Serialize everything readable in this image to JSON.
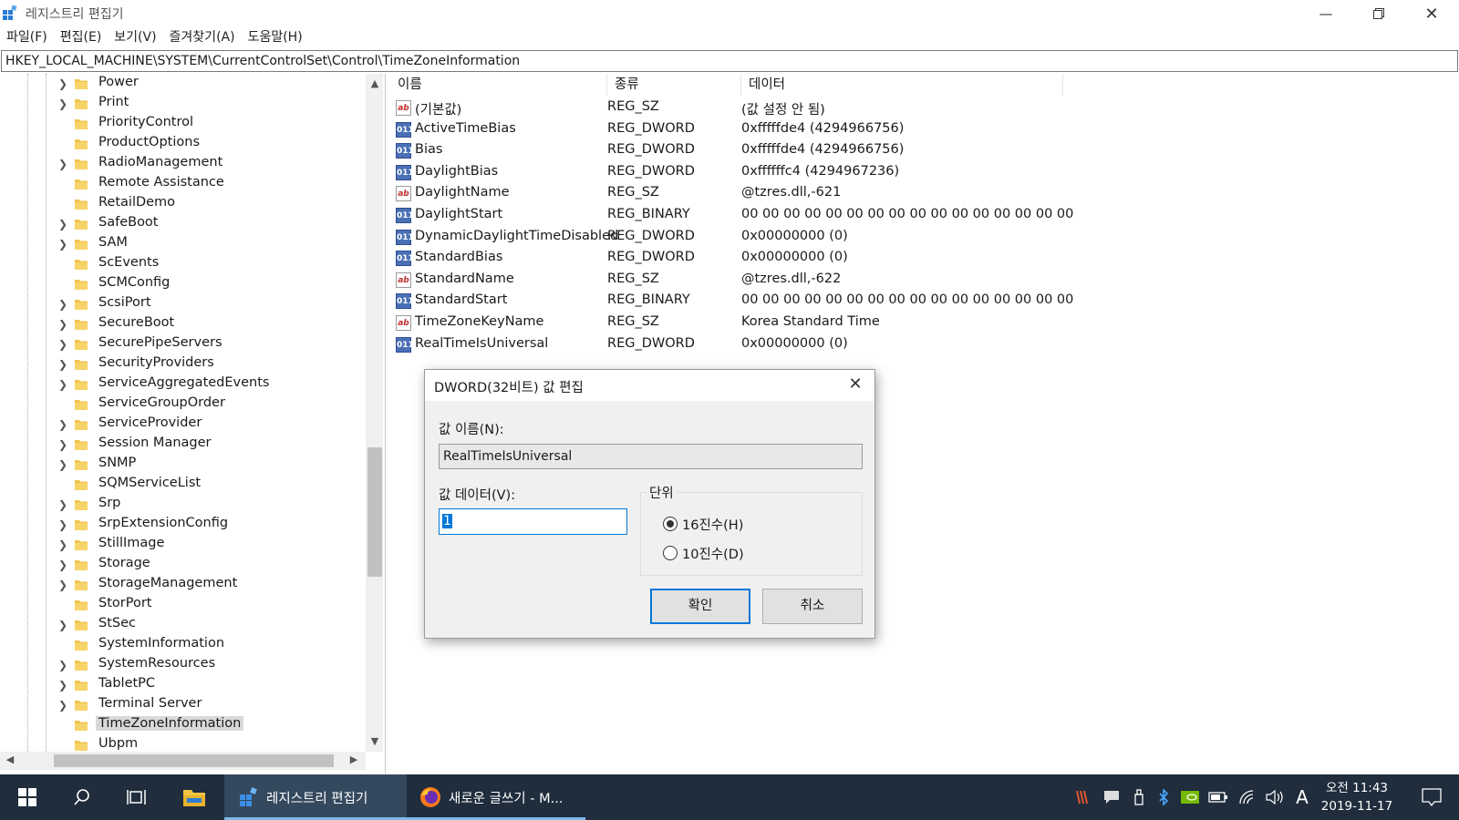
{
  "window": {
    "title": "레지스트리 편집기",
    "minimize_icon": "minimize-icon",
    "maximize_icon": "restore-icon",
    "close_icon": "close-icon"
  },
  "menu": [
    "파일(F)",
    "편집(E)",
    "보기(V)",
    "즐겨찾기(A)",
    "도움말(H)"
  ],
  "address": "HKEY_LOCAL_MACHINE\\SYSTEM\\CurrentControlSet\\Control\\TimeZoneInformation",
  "tree": {
    "items": [
      {
        "label": "Power",
        "expandable": true
      },
      {
        "label": "Print",
        "expandable": true
      },
      {
        "label": "PriorityControl",
        "expandable": false
      },
      {
        "label": "ProductOptions",
        "expandable": false
      },
      {
        "label": "RadioManagement",
        "expandable": true
      },
      {
        "label": "Remote Assistance",
        "expandable": false
      },
      {
        "label": "RetailDemo",
        "expandable": false
      },
      {
        "label": "SafeBoot",
        "expandable": true
      },
      {
        "label": "SAM",
        "expandable": true
      },
      {
        "label": "ScEvents",
        "expandable": false
      },
      {
        "label": "SCMConfig",
        "expandable": false
      },
      {
        "label": "ScsiPort",
        "expandable": true
      },
      {
        "label": "SecureBoot",
        "expandable": true
      },
      {
        "label": "SecurePipeServers",
        "expandable": true
      },
      {
        "label": "SecurityProviders",
        "expandable": true
      },
      {
        "label": "ServiceAggregatedEvents",
        "expandable": true
      },
      {
        "label": "ServiceGroupOrder",
        "expandable": false
      },
      {
        "label": "ServiceProvider",
        "expandable": true
      },
      {
        "label": "Session Manager",
        "expandable": true
      },
      {
        "label": "SNMP",
        "expandable": true
      },
      {
        "label": "SQMServiceList",
        "expandable": false
      },
      {
        "label": "Srp",
        "expandable": true
      },
      {
        "label": "SrpExtensionConfig",
        "expandable": true
      },
      {
        "label": "StillImage",
        "expandable": true
      },
      {
        "label": "Storage",
        "expandable": true
      },
      {
        "label": "StorageManagement",
        "expandable": true
      },
      {
        "label": "StorPort",
        "expandable": false
      },
      {
        "label": "StSec",
        "expandable": true
      },
      {
        "label": "SystemInformation",
        "expandable": false
      },
      {
        "label": "SystemResources",
        "expandable": true
      },
      {
        "label": "TabletPC",
        "expandable": true
      },
      {
        "label": "Terminal Server",
        "expandable": true
      },
      {
        "label": "TimeZoneInformation",
        "expandable": false,
        "selected": true
      },
      {
        "label": "Ubpm",
        "expandable": false
      }
    ]
  },
  "list": {
    "headers": [
      "이름",
      "종류",
      "데이터"
    ],
    "rows": [
      {
        "icon": "sz",
        "name": "(기본값)",
        "type": "REG_SZ",
        "data": "(값 설정 안 됨)"
      },
      {
        "icon": "bin",
        "name": "ActiveTimeBias",
        "type": "REG_DWORD",
        "data": "0xfffffde4 (4294966756)"
      },
      {
        "icon": "bin",
        "name": "Bias",
        "type": "REG_DWORD",
        "data": "0xfffffde4 (4294966756)"
      },
      {
        "icon": "bin",
        "name": "DaylightBias",
        "type": "REG_DWORD",
        "data": "0xffffffc4 (4294967236)"
      },
      {
        "icon": "sz",
        "name": "DaylightName",
        "type": "REG_SZ",
        "data": "@tzres.dll,-621"
      },
      {
        "icon": "bin",
        "name": "DaylightStart",
        "type": "REG_BINARY",
        "data": "00 00 00 00 00 00 00 00 00 00 00 00 00 00 00 00"
      },
      {
        "icon": "bin",
        "name": "DynamicDaylightTimeDisabled",
        "type": "REG_DWORD",
        "data": "0x00000000 (0)"
      },
      {
        "icon": "bin",
        "name": "StandardBias",
        "type": "REG_DWORD",
        "data": "0x00000000 (0)"
      },
      {
        "icon": "sz",
        "name": "StandardName",
        "type": "REG_SZ",
        "data": "@tzres.dll,-622"
      },
      {
        "icon": "bin",
        "name": "StandardStart",
        "type": "REG_BINARY",
        "data": "00 00 00 00 00 00 00 00 00 00 00 00 00 00 00 00"
      },
      {
        "icon": "sz",
        "name": "TimeZoneKeyName",
        "type": "REG_SZ",
        "data": "Korea Standard Time"
      },
      {
        "icon": "bin",
        "name": "RealTimeIsUniversal",
        "type": "REG_DWORD",
        "data": "0x00000000 (0)"
      }
    ],
    "icon_text": {
      "sz": "ab",
      "bin": "011"
    }
  },
  "dialog": {
    "title": "DWORD(32비트) 값 편집",
    "name_label": "값 이름(N):",
    "name_value": "RealTimeIsUniversal",
    "data_label": "값 데이터(V):",
    "data_value": "1",
    "unit_label": "단위",
    "radio_hex": "16진수(H)",
    "radio_dec": "10진수(D)",
    "selected_unit": "hex",
    "ok": "확인",
    "cancel": "취소"
  },
  "taskbar": {
    "apps": [
      {
        "label": "레지스트리 편집기",
        "icon": "regedit-icon",
        "active": true
      },
      {
        "label": "새로운 글쓰기 - M...",
        "icon": "firefox-icon",
        "active": false
      }
    ],
    "ime": "A",
    "time": "오전 11:43",
    "date": "2019-11-17"
  }
}
